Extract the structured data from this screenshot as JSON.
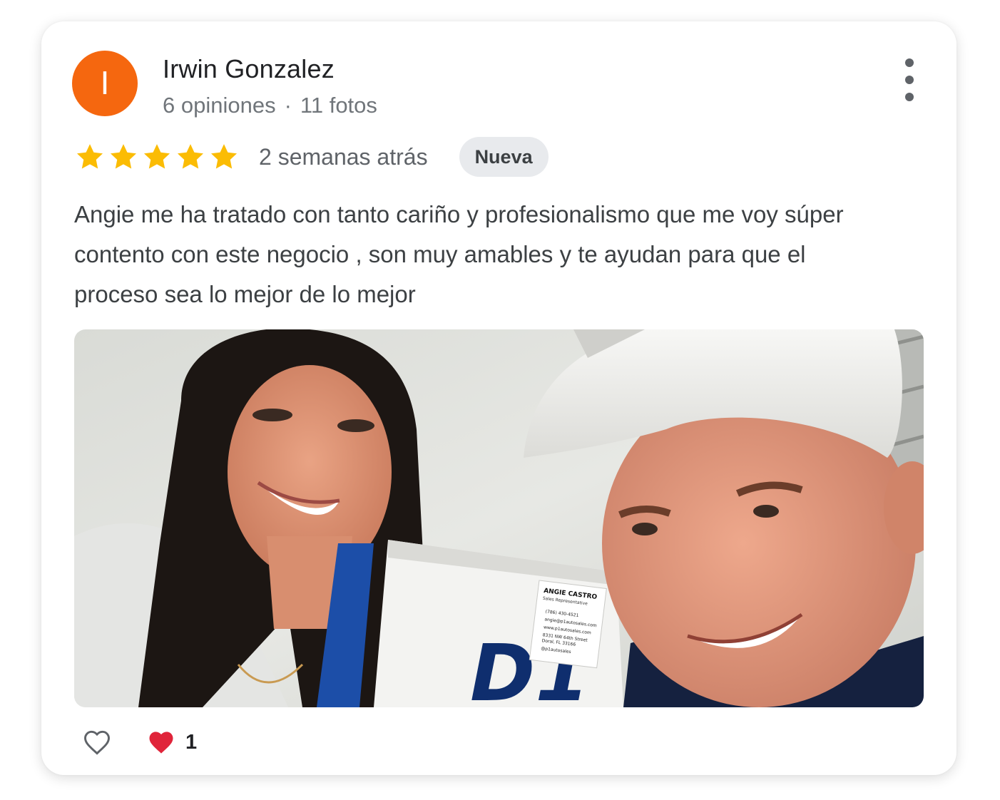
{
  "review": {
    "author": {
      "initial": "I",
      "name": "Irwin Gonzalez",
      "reviews_count": "6 opiniones",
      "separator": "·",
      "photos_count": "11 fotos",
      "avatar_color": "#f5670f"
    },
    "rating": 5,
    "star_color": "#fbbc04",
    "date": "2 semanas atrás",
    "badge": "Nueva",
    "text": "Angie me ha tratado con tanto cariño y profesionalismo que me voy súper contento con este negocio , son muy amables y te ayudan para que el proceso sea lo mejor de lo mejor",
    "photo": {
      "card_name": "ANGIE CASTRO",
      "card_title": "Sales Representative",
      "card_lines": [
        "(786) 430-4521",
        "angie@p1autosales.com",
        "www.p1autosales.com",
        "8331 NW 64th Street",
        "Doral, FL 33166",
        "@p1autosales"
      ],
      "logo_text": "D1"
    },
    "reactions": {
      "like_icon": "heart-outline-icon",
      "love_icon": "heart-filled-icon",
      "love_color": "#e0243a",
      "love_count": "1"
    }
  }
}
